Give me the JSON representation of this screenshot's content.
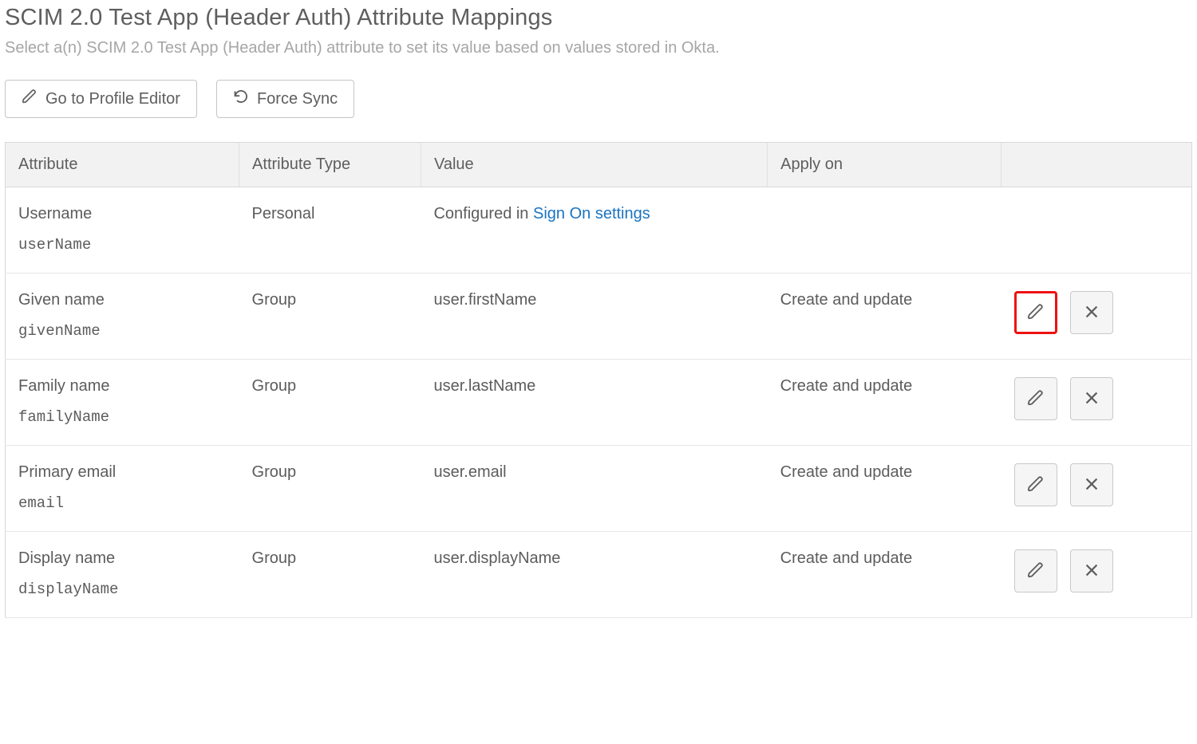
{
  "header": {
    "title": "SCIM 2.0 Test App (Header Auth) Attribute Mappings",
    "subtitle": "Select a(n) SCIM 2.0 Test App (Header Auth) attribute to set its value based on values stored in Okta."
  },
  "toolbar": {
    "profile_editor_label": "Go to Profile Editor",
    "force_sync_label": "Force Sync"
  },
  "table": {
    "headers": {
      "attribute": "Attribute",
      "attribute_type": "Attribute Type",
      "value": "Value",
      "apply_on": "Apply on"
    },
    "rows": [
      {
        "label": "Username",
        "key": "userName",
        "type": "Personal",
        "value_prefix": "Configured in ",
        "value_link": "Sign On settings",
        "apply_on": "",
        "has_actions": false,
        "highlighted": false
      },
      {
        "label": "Given name",
        "key": "givenName",
        "type": "Group",
        "value": "user.firstName",
        "apply_on": "Create and update",
        "has_actions": true,
        "highlighted": true
      },
      {
        "label": "Family name",
        "key": "familyName",
        "type": "Group",
        "value": "user.lastName",
        "apply_on": "Create and update",
        "has_actions": true,
        "highlighted": false
      },
      {
        "label": "Primary email",
        "key": "email",
        "type": "Group",
        "value": "user.email",
        "apply_on": "Create and update",
        "has_actions": true,
        "highlighted": false
      },
      {
        "label": "Display name",
        "key": "displayName",
        "type": "Group",
        "value": "user.displayName",
        "apply_on": "Create and update",
        "has_actions": true,
        "highlighted": false
      }
    ]
  }
}
